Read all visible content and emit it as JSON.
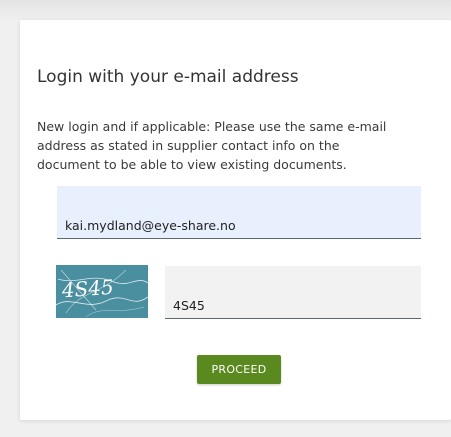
{
  "login": {
    "title": "Login with your e-mail address",
    "instructions": "New login and if applicable: Please use the same e-mail address as stated in supplier contact info on the document to be able to view existing documents.",
    "email_value": "kai.mydland@eye-share.no",
    "captcha_image_text": "4S45",
    "captcha_value": "4S45",
    "proceed_label": "PROCEED"
  },
  "colors": {
    "proceed_button": "#5a8a1f",
    "email_field_bg": "#e8f0fe",
    "captcha_bg": "#4a8fa0"
  }
}
